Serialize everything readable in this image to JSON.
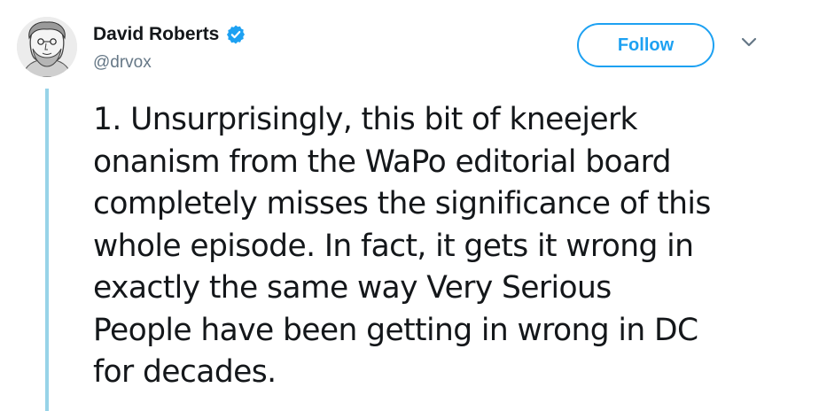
{
  "tweet": {
    "author": {
      "name": "David Roberts",
      "handle": "@drvox",
      "verified": true,
      "avatar_icon": "avatar-illustration-icon"
    },
    "follow_label": "Follow",
    "more_icon": "chevron-down-icon",
    "text_lines": [
      "1. Unsurprisingly, this bit of kneejerk",
      "onanism from the WaPo editorial board",
      "completely misses the significance of this",
      "whole episode. In fact, it gets it wrong in",
      "exactly the same way Very Serious",
      "People have been getting in wrong in DC",
      "for decades."
    ]
  },
  "colors": {
    "accent": "#1da1f2",
    "thread_line": "#97d3e8",
    "handle": "#657786",
    "text": "#14171a"
  }
}
